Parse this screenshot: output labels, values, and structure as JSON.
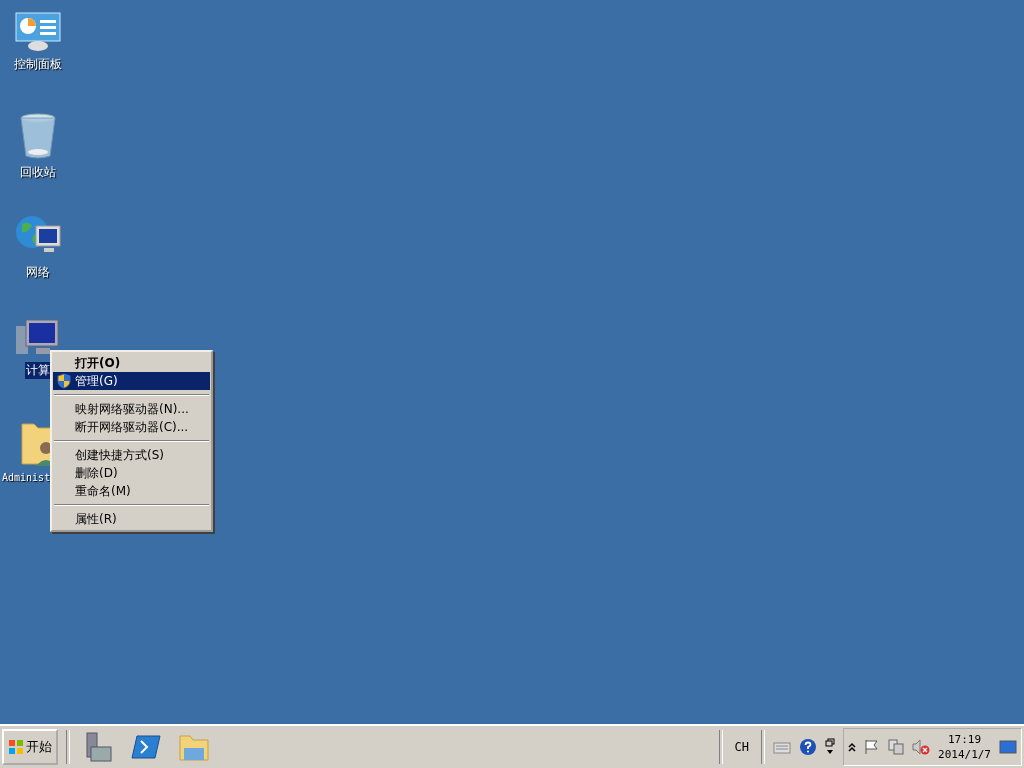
{
  "desktop": {
    "icons": [
      {
        "kind": "control-panel",
        "label": "控制面板",
        "selected": false
      },
      {
        "kind": "recycle-bin",
        "label": "回收站",
        "selected": false
      },
      {
        "kind": "network",
        "label": "网络",
        "selected": false
      },
      {
        "kind": "computer",
        "label": "计算",
        "selected": true
      },
      {
        "kind": "user-folder",
        "label": "Administ",
        "selected": false
      }
    ]
  },
  "context_menu": {
    "items": [
      {
        "kind": "item",
        "label": "打开(O)",
        "default": true,
        "selected": false
      },
      {
        "kind": "item",
        "label": "管理(G)",
        "default": false,
        "selected": true,
        "shield": true
      },
      {
        "kind": "separator"
      },
      {
        "kind": "item",
        "label": "映射网络驱动器(N)...",
        "default": false,
        "selected": false
      },
      {
        "kind": "item",
        "label": "断开网络驱动器(C)...",
        "default": false,
        "selected": false
      },
      {
        "kind": "separator"
      },
      {
        "kind": "item",
        "label": "创建快捷方式(S)",
        "default": false,
        "selected": false
      },
      {
        "kind": "item",
        "label": "删除(D)",
        "default": false,
        "selected": false
      },
      {
        "kind": "item",
        "label": "重命名(M)",
        "default": false,
        "selected": false
      },
      {
        "kind": "separator"
      },
      {
        "kind": "item",
        "label": "属性(R)",
        "default": false,
        "selected": false
      }
    ]
  },
  "taskbar": {
    "start": "开始",
    "quick_launch": [
      {
        "kind": "server-manager"
      },
      {
        "kind": "powershell"
      },
      {
        "kind": "explorer"
      }
    ],
    "language": "CH",
    "clock": {
      "time": "17:19",
      "date": "2014/1/7"
    }
  }
}
